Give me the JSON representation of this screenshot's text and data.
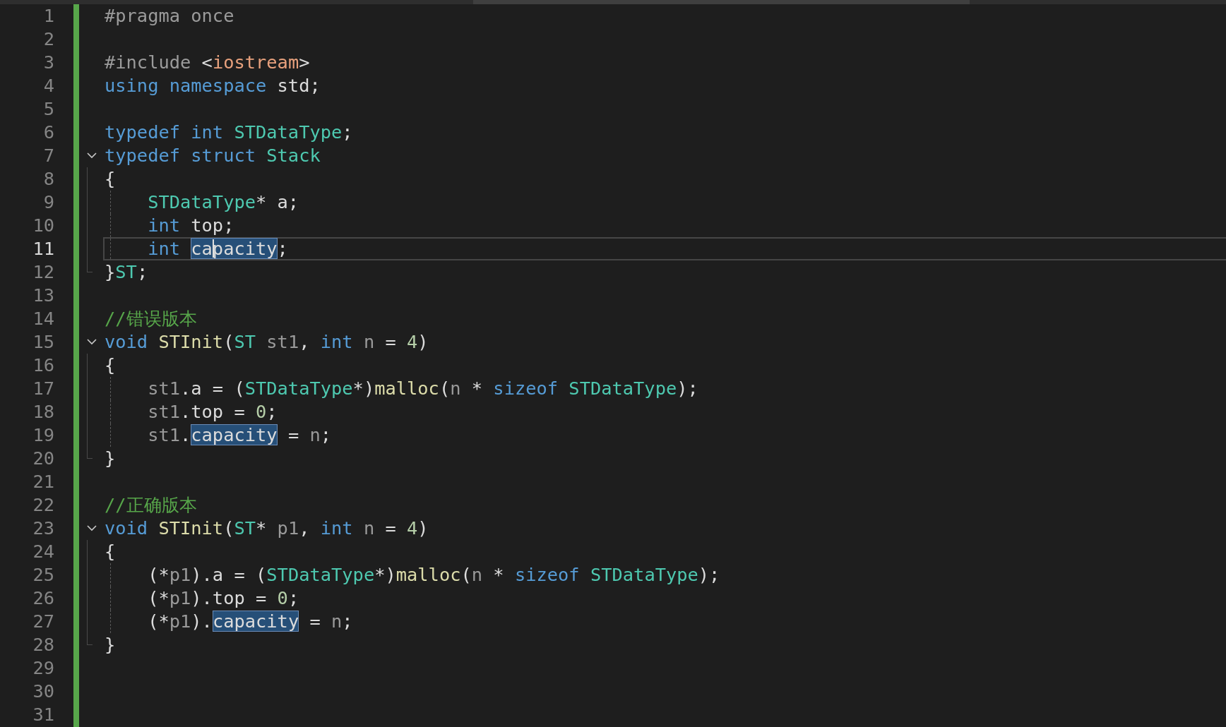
{
  "editor": {
    "lines": [
      {
        "number": "1",
        "tokens": [
          {
            "text": "#pragma once",
            "kind": "pre"
          }
        ]
      },
      {
        "number": "2"
      },
      {
        "number": "3",
        "tokens": [
          {
            "text": "#include ",
            "kind": "pre"
          },
          {
            "text": "<",
            "kind": "text"
          },
          {
            "text": "iostream",
            "kind": "str"
          },
          {
            "text": ">",
            "kind": "text"
          }
        ]
      },
      {
        "number": "4",
        "tokens": [
          {
            "text": "using namespace",
            "kind": "kw"
          },
          {
            "text": " std;",
            "kind": "text"
          }
        ]
      },
      {
        "number": "5"
      },
      {
        "number": "6",
        "tokens": [
          {
            "text": "typedef int ",
            "kind": "kw"
          },
          {
            "text": "STDataType",
            "kind": "type"
          },
          {
            "text": ";",
            "kind": "text"
          }
        ]
      },
      {
        "number": "7",
        "expanded": true,
        "tokens": [
          {
            "text": "typedef struct ",
            "kind": "kw"
          },
          {
            "text": "Stack",
            "kind": "type"
          }
        ],
        "children": [
          {
            "number": "8",
            "tokens": [
              {
                "text": "{",
                "kind": "text"
              }
            ]
          },
          {
            "number": "9",
            "indented": true,
            "tokens": [
              {
                "text": "STDataType",
                "kind": "type"
              },
              {
                "text": "* a;",
                "kind": "text"
              }
            ]
          },
          {
            "number": "10",
            "indented": true,
            "tokens": [
              {
                "text": "int ",
                "kind": "kw"
              },
              {
                "text": "top;",
                "kind": "text"
              }
            ]
          },
          {
            "number": "11",
            "indented": true,
            "current": true,
            "tokens": [
              {
                "text": "int ",
                "kind": "kw"
              },
              {
                "text": "capacity",
                "kind": "text",
                "highlighted": true,
                "caret": true
              },
              {
                "text": ";",
                "kind": "text"
              }
            ]
          },
          {
            "number": "12",
            "tokens": [
              {
                "text": "}",
                "kind": "text"
              },
              {
                "text": "ST",
                "kind": "type"
              },
              {
                "text": ";",
                "kind": "text"
              }
            ]
          }
        ]
      },
      {
        "number": "13"
      },
      {
        "number": "14",
        "tokens": [
          {
            "text": "//错误版本",
            "kind": "cmt"
          }
        ]
      },
      {
        "number": "15",
        "expanded": true,
        "tokens": [
          {
            "text": "void ",
            "kind": "kw"
          },
          {
            "text": "STInit",
            "kind": "fn"
          },
          {
            "text": "(",
            "kind": "text"
          },
          {
            "text": "ST",
            "kind": "type"
          },
          {
            "text": " st1",
            "kind": "param"
          },
          {
            "text": ", ",
            "kind": "text"
          },
          {
            "text": "int",
            "kind": "kw"
          },
          {
            "text": " n",
            "kind": "param"
          },
          {
            "text": " = ",
            "kind": "text"
          },
          {
            "text": "4",
            "kind": "num"
          },
          {
            "text": ")",
            "kind": "text"
          }
        ],
        "children": [
          {
            "number": "16",
            "tokens": [
              {
                "text": "{",
                "kind": "text"
              }
            ]
          },
          {
            "number": "17",
            "indented": true,
            "tokens": [
              {
                "text": "st1",
                "kind": "param"
              },
              {
                "text": ".a = (",
                "kind": "text"
              },
              {
                "text": "STDataType",
                "kind": "type"
              },
              {
                "text": "*)",
                "kind": "text"
              },
              {
                "text": "malloc",
                "kind": "fn"
              },
              {
                "text": "(",
                "kind": "text"
              },
              {
                "text": "n",
                "kind": "param"
              },
              {
                "text": " * ",
                "kind": "text"
              },
              {
                "text": "sizeof ",
                "kind": "kw"
              },
              {
                "text": "STDataType",
                "kind": "type"
              },
              {
                "text": ");",
                "kind": "text"
              }
            ]
          },
          {
            "number": "18",
            "indented": true,
            "tokens": [
              {
                "text": "st1",
                "kind": "param"
              },
              {
                "text": ".top = ",
                "kind": "text"
              },
              {
                "text": "0",
                "kind": "num"
              },
              {
                "text": ";",
                "kind": "text"
              }
            ]
          },
          {
            "number": "19",
            "indented": true,
            "tokens": [
              {
                "text": "st1",
                "kind": "param"
              },
              {
                "text": ".",
                "kind": "text"
              },
              {
                "text": "capacity",
                "kind": "text",
                "highlighted": true,
                "caret": false
              },
              {
                "text": " = ",
                "kind": "text"
              },
              {
                "text": "n",
                "kind": "param"
              },
              {
                "text": ";",
                "kind": "text"
              }
            ]
          },
          {
            "number": "20",
            "tokens": [
              {
                "text": "}",
                "kind": "text"
              }
            ]
          }
        ]
      },
      {
        "number": "21"
      },
      {
        "number": "22",
        "tokens": [
          {
            "text": "//正确版本",
            "kind": "cmt"
          }
        ]
      },
      {
        "number": "23",
        "expanded": true,
        "tokens": [
          {
            "text": "void ",
            "kind": "kw"
          },
          {
            "text": "STInit",
            "kind": "fn"
          },
          {
            "text": "(",
            "kind": "text"
          },
          {
            "text": "ST",
            "kind": "type"
          },
          {
            "text": "* ",
            "kind": "text"
          },
          {
            "text": "p1",
            "kind": "param"
          },
          {
            "text": ", ",
            "kind": "text"
          },
          {
            "text": "int",
            "kind": "kw"
          },
          {
            "text": " n",
            "kind": "param"
          },
          {
            "text": " = ",
            "kind": "text"
          },
          {
            "text": "4",
            "kind": "num"
          },
          {
            "text": ")",
            "kind": "text"
          }
        ],
        "children": [
          {
            "number": "24",
            "tokens": [
              {
                "text": "{",
                "kind": "text"
              }
            ]
          },
          {
            "number": "25",
            "indented": true,
            "tokens": [
              {
                "text": "(*",
                "kind": "text"
              },
              {
                "text": "p1",
                "kind": "param"
              },
              {
                "text": ").a = (",
                "kind": "text"
              },
              {
                "text": "STDataType",
                "kind": "type"
              },
              {
                "text": "*)",
                "kind": "text"
              },
              {
                "text": "malloc",
                "kind": "fn"
              },
              {
                "text": "(",
                "kind": "text"
              },
              {
                "text": "n",
                "kind": "param"
              },
              {
                "text": " * ",
                "kind": "text"
              },
              {
                "text": "sizeof ",
                "kind": "kw"
              },
              {
                "text": "STDataType",
                "kind": "type"
              },
              {
                "text": ");",
                "kind": "text"
              }
            ]
          },
          {
            "number": "26",
            "indented": true,
            "tokens": [
              {
                "text": "(*",
                "kind": "text"
              },
              {
                "text": "p1",
                "kind": "param"
              },
              {
                "text": ").top = ",
                "kind": "text"
              },
              {
                "text": "0",
                "kind": "num"
              },
              {
                "text": ";",
                "kind": "text"
              }
            ]
          },
          {
            "number": "27",
            "indented": true,
            "tokens": [
              {
                "text": "(*",
                "kind": "text"
              },
              {
                "text": "p1",
                "kind": "param"
              },
              {
                "text": ").",
                "kind": "text"
              },
              {
                "text": "capacity",
                "kind": "text",
                "highlighted": true,
                "caret": false
              },
              {
                "text": " = ",
                "kind": "text"
              },
              {
                "text": "n",
                "kind": "param"
              },
              {
                "text": ";",
                "kind": "text"
              }
            ]
          },
          {
            "number": "28",
            "tokens": [
              {
                "text": "}",
                "kind": "text"
              }
            ]
          }
        ]
      },
      {
        "number": "29"
      },
      {
        "number": "30"
      },
      {
        "number": "31"
      }
    ]
  }
}
